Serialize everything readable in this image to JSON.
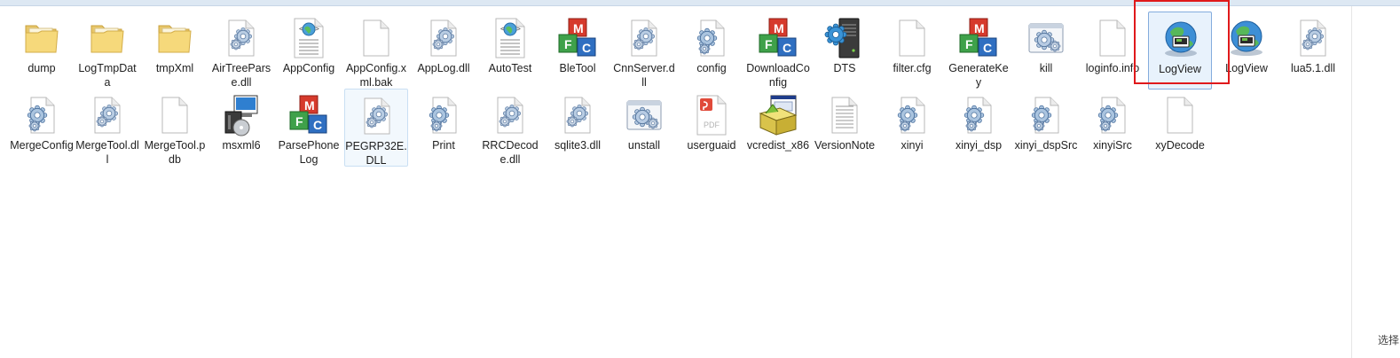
{
  "status": {
    "select_hint": "选择"
  },
  "items": [
    {
      "name": "dump",
      "icon": "folder-icon"
    },
    {
      "name": "LogTmpData",
      "icon": "folder-icon"
    },
    {
      "name": "tmpXml",
      "icon": "folder-icon"
    },
    {
      "name": "AirTreeParse.dll",
      "icon": "dll-gear-icon"
    },
    {
      "name": "AppConfig",
      "icon": "xml-globe-doc-icon"
    },
    {
      "name": "AppConfig.xml.bak",
      "icon": "blank-file-icon"
    },
    {
      "name": "AppLog.dll",
      "icon": "dll-gear-icon"
    },
    {
      "name": "AutoTest",
      "icon": "xml-globe-doc-icon"
    },
    {
      "name": "BleTool",
      "icon": "mfc-app-icon"
    },
    {
      "name": "CnnServer.dll",
      "icon": "dll-gear-icon"
    },
    {
      "name": "config",
      "icon": "config-gears-icon"
    },
    {
      "name": "DownloadConfig",
      "icon": "mfc-app-icon"
    },
    {
      "name": "DTS",
      "icon": "server-tower-icon"
    },
    {
      "name": "filter.cfg",
      "icon": "blank-file-icon"
    },
    {
      "name": "GenerateKey",
      "icon": "mfc-app-icon"
    },
    {
      "name": "kill",
      "icon": "batch-gear-icon"
    },
    {
      "name": "loginfo.info",
      "icon": "blank-file-icon"
    },
    {
      "name": "LogView",
      "icon": "globe-network-icon"
    },
    {
      "name": "LogView",
      "icon": "globe-network-icon"
    },
    {
      "name": "lua5.1.dll",
      "icon": "dll-gear-icon"
    },
    {
      "name": "MergeConfig",
      "icon": "config-gears-icon"
    },
    {
      "name": "MergeTool.dll",
      "icon": "dll-gear-icon"
    },
    {
      "name": "MergeTool.pdb",
      "icon": "blank-file-icon"
    },
    {
      "name": "msxml6",
      "icon": "installer-package-icon"
    },
    {
      "name": "ParsePhoneLog",
      "icon": "mfc-app-icon"
    },
    {
      "name": "PEGRP32E.DLL",
      "icon": "dll-gear-icon"
    },
    {
      "name": "Print",
      "icon": "config-gears-icon"
    },
    {
      "name": "RRCDecode.dll",
      "icon": "dll-gear-icon"
    },
    {
      "name": "sqlite3.dll",
      "icon": "dll-gear-icon"
    },
    {
      "name": "unstall",
      "icon": "batch-gear-icon"
    },
    {
      "name": "userguaid",
      "icon": "pdf-file-icon"
    },
    {
      "name": "vcredist_x86",
      "icon": "setup-box-icon"
    },
    {
      "name": "VersionNote",
      "icon": "text-file-icon"
    },
    {
      "name": "xinyi",
      "icon": "config-gears-icon"
    },
    {
      "name": "xinyi_dsp",
      "icon": "config-gears-icon"
    },
    {
      "name": "xinyi_dspSrc",
      "icon": "config-gears-icon"
    },
    {
      "name": "xinyiSrc",
      "icon": "config-gears-icon"
    },
    {
      "name": "xyDecode",
      "icon": "blank-file-icon"
    }
  ],
  "colors": {
    "selection_border": "#84acdd",
    "selection_fill": "#e8f2fc",
    "highlight_box": "#e0191b"
  }
}
